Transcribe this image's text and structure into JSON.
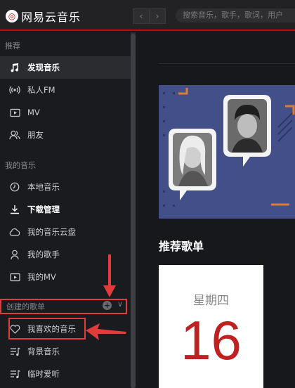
{
  "app": {
    "title": "网易云音乐",
    "logo_glyph": "◎"
  },
  "nav": {
    "back": "‹",
    "forward": "›"
  },
  "search": {
    "placeholder": "搜索音乐，歌手，歌词，用户"
  },
  "sidebar": {
    "recommend_title": "推荐",
    "recommend_items": [
      {
        "label": "发现音乐",
        "icon": "music-note-icon",
        "active": true
      },
      {
        "label": "私人FM",
        "icon": "radio-icon"
      },
      {
        "label": "MV",
        "icon": "video-icon"
      },
      {
        "label": "朋友",
        "icon": "friends-icon"
      }
    ],
    "my_music_title": "我的音乐",
    "my_music_items": [
      {
        "label": "本地音乐",
        "icon": "clock-icon"
      },
      {
        "label": "下载管理",
        "icon": "download-icon"
      },
      {
        "label": "我的音乐云盘",
        "icon": "cloud-icon"
      },
      {
        "label": "我的歌手",
        "icon": "singer-icon"
      },
      {
        "label": "我的MV",
        "icon": "video-icon"
      }
    ],
    "created_title": "创建的歌单",
    "created_plus": "+",
    "created_chevron": "∨",
    "created_items": [
      {
        "label": "我喜欢的音乐",
        "icon": "heart-icon"
      },
      {
        "label": "背景音乐",
        "icon": "playlist-icon"
      },
      {
        "label": "临时爱听",
        "icon": "playlist-icon"
      }
    ]
  },
  "main": {
    "recommend_playlists_title": "推荐歌单",
    "daily_card": {
      "weekday": "星期四",
      "day": "16"
    }
  },
  "colors": {
    "accent": "#c20c0c",
    "annotation": "#e23b3b",
    "banner": "#434f88"
  }
}
